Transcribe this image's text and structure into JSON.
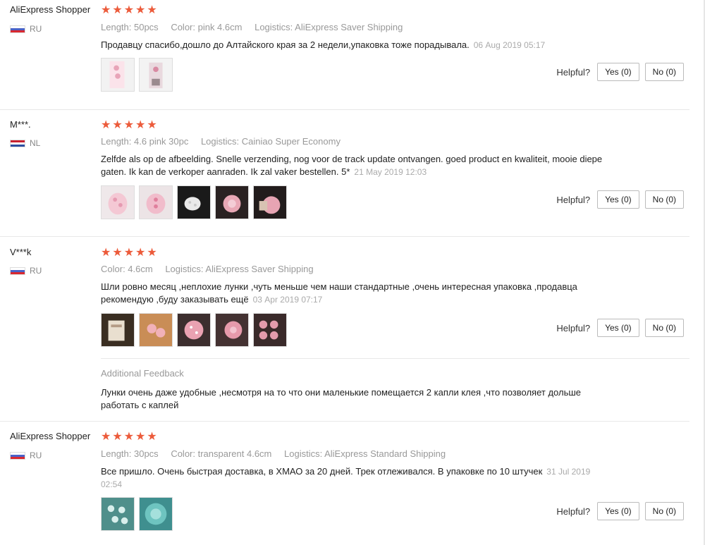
{
  "helpful_label": "Helpful?",
  "reviews": [
    {
      "user": "AliExpress Shopper",
      "country": "RU",
      "rating": 5,
      "stars": "★★★★★",
      "meta": [
        "Length: 50pcs",
        "Color: pink 4.6cm",
        "Logistics: AliExpress Saver Shipping"
      ],
      "text": "Продавцу спасибо,дошло до Алтайского края за 2 недели,упаковка тоже порадывала.",
      "date": "06 Aug 2019 05:17",
      "yes": "Yes (0)",
      "no": "No (0)"
    },
    {
      "user": "M***.",
      "country": "NL",
      "rating": 5,
      "stars": "★★★★★",
      "meta": [
        "Length: 4.6 pink 30pc",
        "Logistics: Cainiao Super Economy"
      ],
      "text": "Zelfde als op de afbeelding. Snelle verzending, nog voor de track update ontvangen. goed product en kwaliteit, mooie diepe gaten. Ik kan de verkoper aanraden. Ik zal vaker bestellen. 5*",
      "date": "21 May 2019 12:03",
      "yes": "Yes (0)",
      "no": "No (0)"
    },
    {
      "user": "V***k",
      "country": "RU",
      "rating": 5,
      "stars": "★★★★★",
      "meta": [
        "Color: 4.6cm",
        "Logistics: AliExpress Saver Shipping"
      ],
      "text": "Шли ровно месяц ,неплохие лунки ,чуть меньше чем наши стандартные ,очень интересная упаковка ,продавца рекомендую ,буду заказывать ещё",
      "date": "03 Apr 2019 07:17",
      "yes": "Yes (0)",
      "no": "No (0)",
      "additional_title": "Additional Feedback",
      "additional_text": "Лунки очень даже удобные ,несмотря на то что они маленькие помещается 2 капли клея ,что позволяет дольше работать с каплей"
    },
    {
      "user": "AliExpress Shopper",
      "country": "RU",
      "rating": 5,
      "stars": "★★★★★",
      "meta": [
        "Length: 30pcs",
        "Color: transparent 4.6cm",
        "Logistics: AliExpress Standard Shipping"
      ],
      "text": "Все пришло. Очень быстрая доставка, в ХМАО за 20 дней. Трек отлеживался. В упаковке по 10 штучек",
      "date": "31 Jul 2019 02:54",
      "yes": "Yes (0)",
      "no": "No (0)"
    }
  ],
  "colors": {
    "star": "#ec5b3b",
    "meta": "#999999",
    "border": "#e8e8e8"
  }
}
